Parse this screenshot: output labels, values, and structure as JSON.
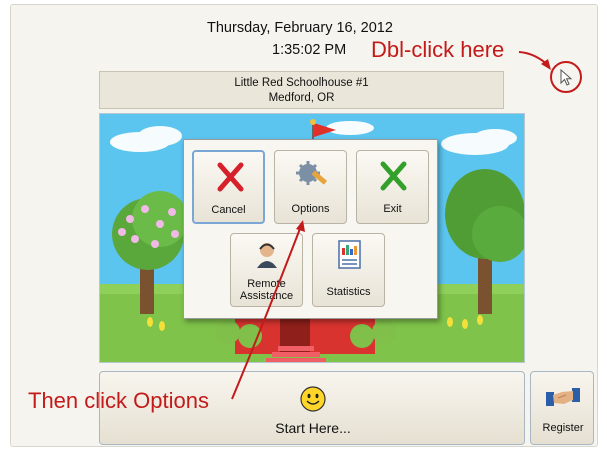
{
  "header": {
    "date": "Thursday, February 16, 2012",
    "time": "1:35:02 PM"
  },
  "annotations": {
    "double_click": "Dbl-click here",
    "then_click": "Then click Options"
  },
  "school": {
    "name": "Little Red Schoolhouse #1",
    "location": "Medford, OR"
  },
  "dialog": {
    "buttons": [
      {
        "label": "Cancel",
        "icon": "red-x-icon"
      },
      {
        "label": "Options",
        "icon": "gear-wrench-icon"
      },
      {
        "label": "Exit",
        "icon": "green-x-icon"
      },
      {
        "label_line1": "Remote",
        "label_line2": "Assistance",
        "icon": "support-person-icon"
      },
      {
        "label": "Statistics",
        "icon": "chart-report-icon"
      }
    ]
  },
  "start": {
    "label": "Start Here...",
    "icon": "smiley-icon"
  },
  "register": {
    "label": "Register",
    "icon": "handshake-icon"
  },
  "colors": {
    "annotation": "#c31a1a",
    "sky": "#5cc5ef",
    "grass": "#7fc34a",
    "school": "#d8332f"
  }
}
